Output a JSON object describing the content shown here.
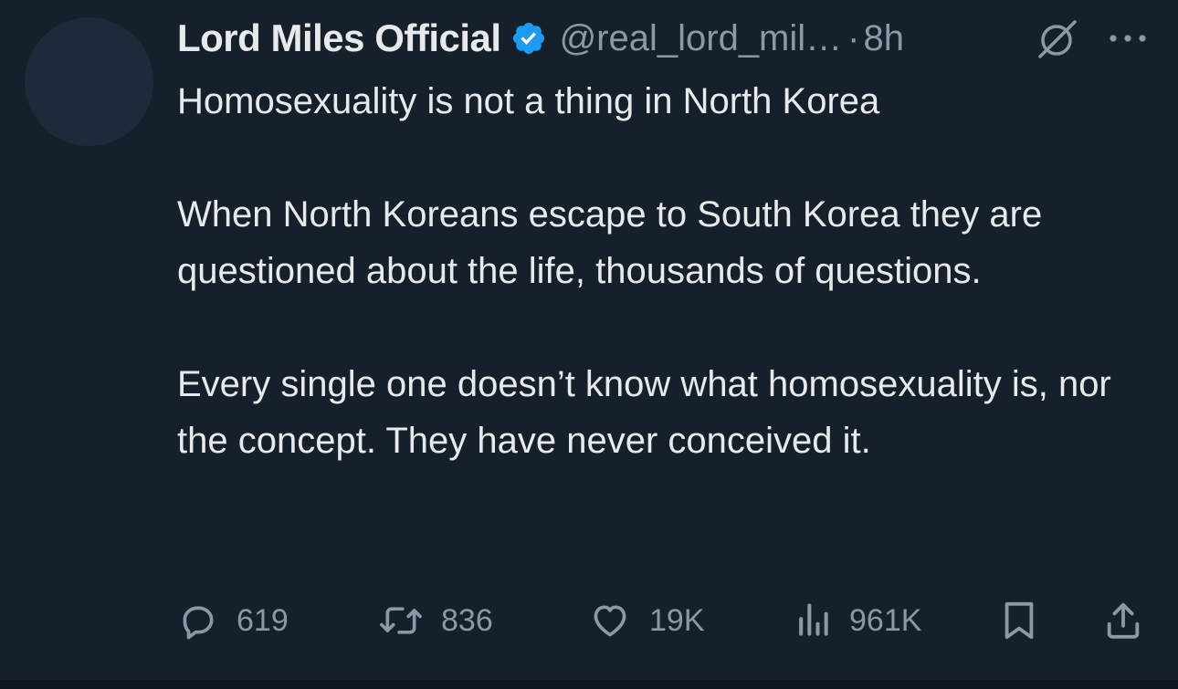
{
  "tweet": {
    "author": {
      "display_name": "Lord Miles Official",
      "handle": "@real_lord_mil…",
      "verified": true
    },
    "separator": "·",
    "time": "8h",
    "paragraphs": [
      "Homosexuality is not a thing in North Korea",
      "When North Koreans escape to South Korea they are questioned about the life, thousands of questions.",
      "Every single one doesn’t know what homosexuality is, nor the concept. They have never conceived it."
    ],
    "stats": {
      "replies": "619",
      "reposts": "836",
      "likes": "19K",
      "views": "961K"
    }
  },
  "icons": {
    "verified": "verified-badge-icon",
    "grok": "grok-icon",
    "more": "more-options-icon",
    "reply": "reply-icon",
    "repost": "repost-icon",
    "like": "heart-icon",
    "views": "views-bar-chart-icon",
    "bookmark": "bookmark-icon",
    "share": "share-icon"
  },
  "colors": {
    "background": "#16202b",
    "text": "#e7e9ea",
    "muted": "#8b98a5",
    "verified": "#1d9bf0"
  }
}
